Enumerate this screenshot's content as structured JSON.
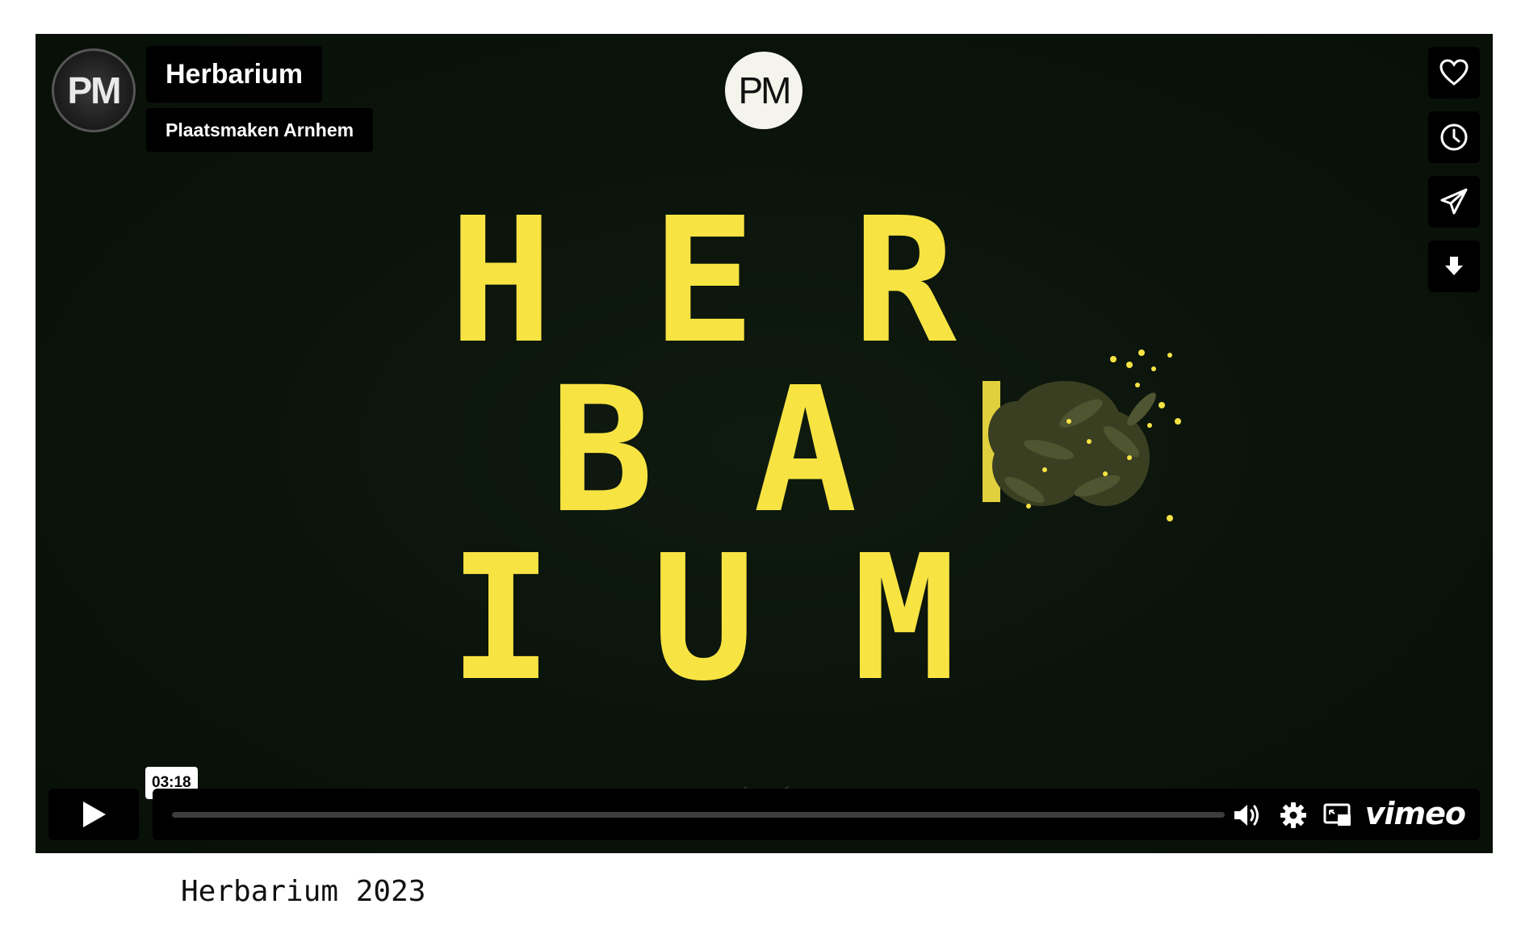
{
  "video": {
    "title": "Herbarium",
    "owner": "Plaatsmaken Arnhem",
    "avatar_text": "PM",
    "center_logo_text": "PM",
    "letters": {
      "row1": [
        "H",
        "E",
        "R"
      ],
      "row2": [
        "B",
        "A"
      ],
      "row3": [
        "I",
        "U",
        "M"
      ]
    },
    "accent_color": "#f7e443",
    "background_color": "#0b140b"
  },
  "side_actions": [
    {
      "icon": "heart-icon"
    },
    {
      "icon": "clock-icon"
    },
    {
      "icon": "send-icon"
    },
    {
      "icon": "download-icon"
    }
  ],
  "controls": {
    "play_icon": "play-icon",
    "hover_time": "03:18",
    "progress": 0,
    "volume_icon": "volume-icon",
    "settings_icon": "gear-icon",
    "pip_icon": "picture-in-picture-icon",
    "brand": "vimeo"
  },
  "caption": "Herbarium 2023"
}
